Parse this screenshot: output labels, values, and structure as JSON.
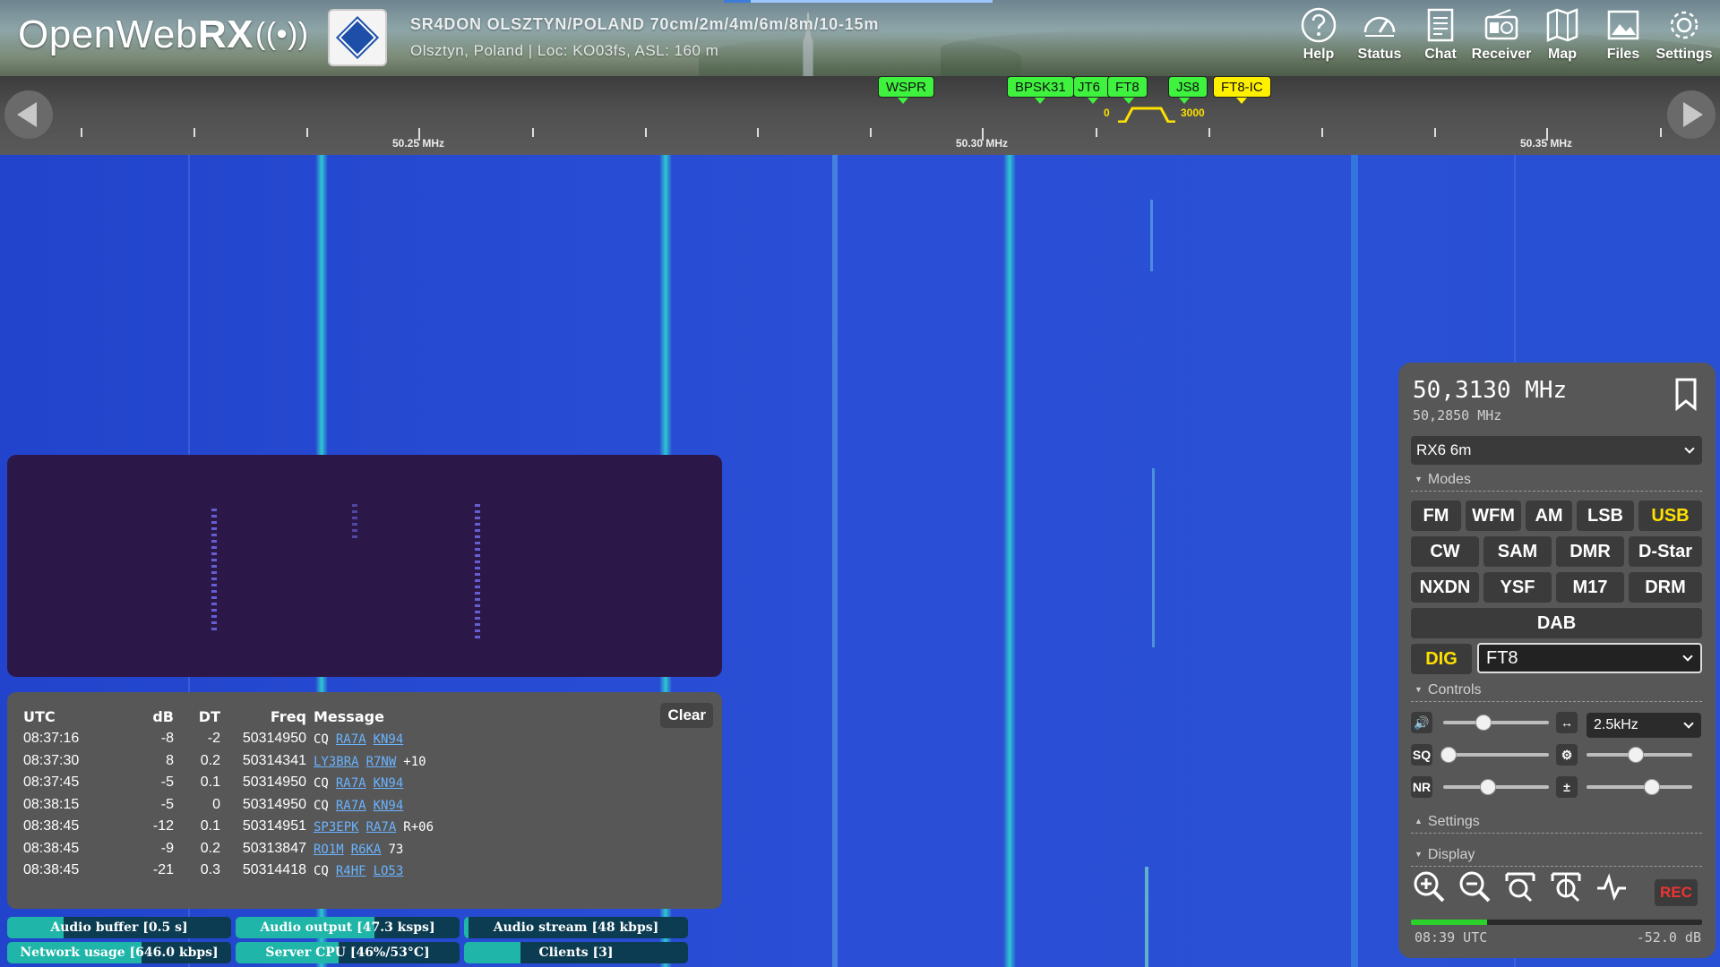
{
  "header": {
    "logo_text": "OpenWeb",
    "logo_rx": "RX",
    "logo_waves": "((•))",
    "station_title": "SR4DON OLSZTYN/POLAND 70cm/2m/4m/6m/8m/10-15m",
    "station_subtitle": "Olsztyn, Poland | Loc: KO03fs, ASL: 160 m",
    "nav": [
      {
        "label": "Help",
        "icon": "help-icon"
      },
      {
        "label": "Status",
        "icon": "gauge-icon"
      },
      {
        "label": "Chat",
        "icon": "document-icon"
      },
      {
        "label": "Receiver",
        "icon": "radio-icon"
      },
      {
        "label": "Map",
        "icon": "map-icon"
      },
      {
        "label": "Files",
        "icon": "image-icon"
      },
      {
        "label": "Settings",
        "icon": "gear-icon"
      }
    ]
  },
  "scale": {
    "labels": [
      "50.25 MHz",
      "50.30 MHz",
      "50.35 MHz"
    ],
    "bookmarks": [
      {
        "label": "WSPR",
        "color": "#3ef23e"
      },
      {
        "label": "BPSK31",
        "color": "#3ef23e"
      },
      {
        "label": "JT6",
        "color": "#3ef23e"
      },
      {
        "label": "FT8",
        "color": "#3ef23e"
      },
      {
        "label": "JS8",
        "color": "#3ef23e"
      },
      {
        "label": "FT8-IC",
        "color": "#fff000"
      }
    ],
    "passband_low": "0",
    "passband_high": "3000"
  },
  "digi": {
    "columns": [
      "UTC",
      "dB",
      "DT",
      "Freq",
      "Message"
    ],
    "clear_label": "Clear",
    "rows": [
      {
        "utc": "08:37:16",
        "db": "-8",
        "dt": "-2",
        "freq": "50314950",
        "msg": [
          {
            "t": "CQ",
            "link": false
          },
          {
            "t": "RA7A",
            "link": true
          },
          {
            "t": "KN94",
            "link": true
          }
        ]
      },
      {
        "utc": "08:37:30",
        "db": "8",
        "dt": "0.2",
        "freq": "50314341",
        "msg": [
          {
            "t": "LY3BRA",
            "link": true
          },
          {
            "t": "R7NW",
            "link": true
          },
          {
            "t": "+10",
            "link": false
          }
        ]
      },
      {
        "utc": "08:37:45",
        "db": "-5",
        "dt": "0.1",
        "freq": "50314950",
        "msg": [
          {
            "t": "CQ",
            "link": false
          },
          {
            "t": "RA7A",
            "link": true
          },
          {
            "t": "KN94",
            "link": true
          }
        ]
      },
      {
        "utc": "08:38:15",
        "db": "-5",
        "dt": "0",
        "freq": "50314950",
        "msg": [
          {
            "t": "CQ",
            "link": false
          },
          {
            "t": "RA7A",
            "link": true
          },
          {
            "t": "KN94",
            "link": true
          }
        ]
      },
      {
        "utc": "08:38:45",
        "db": "-12",
        "dt": "0.1",
        "freq": "50314951",
        "msg": [
          {
            "t": "SP3EPK",
            "link": true
          },
          {
            "t": "RA7A",
            "link": true
          },
          {
            "t": "R+06",
            "link": false
          }
        ]
      },
      {
        "utc": "08:38:45",
        "db": "-9",
        "dt": "0.2",
        "freq": "50313847",
        "msg": [
          {
            "t": "RO1M",
            "link": true
          },
          {
            "t": "R6KA",
            "link": true
          },
          {
            "t": "73",
            "link": false
          }
        ]
      },
      {
        "utc": "08:38:45",
        "db": "-21",
        "dt": "0.3",
        "freq": "50314418",
        "msg": [
          {
            "t": "CQ",
            "link": false
          },
          {
            "t": "R4HF",
            "link": true
          },
          {
            "t": "LO53",
            "link": true
          }
        ]
      }
    ]
  },
  "status_bars": [
    {
      "label": "Audio buffer [0.5 s]",
      "fill": 0.25
    },
    {
      "label": "Audio output [47.3 ksps]",
      "fill": 0.62
    },
    {
      "label": "Audio stream [48 kbps]",
      "fill": 0.02
    },
    {
      "label": "Network usage [646.0 kbps]",
      "fill": 0.6
    },
    {
      "label": "Server CPU [46%/53°C]",
      "fill": 0.46
    },
    {
      "label": "Clients [3]",
      "fill": 0.25
    }
  ],
  "receiver": {
    "frequency": "50,3130 MHz",
    "center_frequency": "50,2850 MHz",
    "profile": "RX6 6m",
    "modes_header": "Modes",
    "modes": [
      "FM",
      "WFM",
      "AM",
      "LSB",
      "USB",
      "CW",
      "SAM",
      "DMR",
      "D-Star",
      "NXDN",
      "YSF",
      "M17",
      "DRM",
      "DAB"
    ],
    "active_mode": "USB",
    "dig_label": "DIG",
    "dig_mode": "FT8",
    "controls_header": "Controls",
    "bandwidth": "2.5kHz",
    "sq_label": "SQ",
    "nr_label": "NR",
    "volume": 0.38,
    "squelch": 0.05,
    "noise_reduction": 0.42,
    "agc": 0.47,
    "gain": 0.62,
    "settings_header": "Settings",
    "display_header": "Display",
    "rec_label": "REC",
    "smeter_fill": 0.26,
    "clock": "08:39 UTC",
    "level": "-52.0 dB"
  }
}
